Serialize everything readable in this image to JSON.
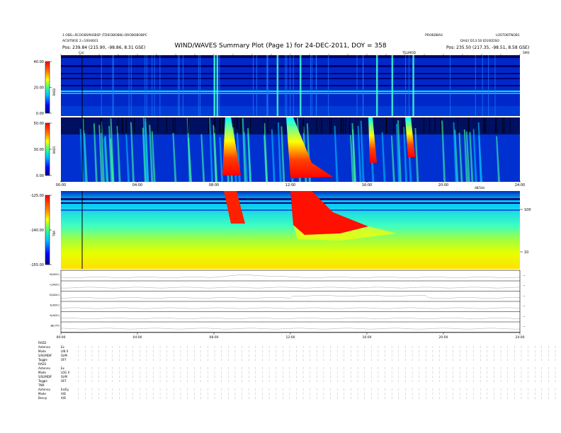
{
  "header": {
    "title": "WIND/WAVES Summary Plot (Page 1) for 24-DEC-2011, DOY = 358",
    "left_line1": "1 OBS=RCOOBSPAOBSP (TDIEOBOBN)-OROBOBOBPC",
    "left_line2": "ACSITBOE 2=1004601",
    "left_line3": "Pos:  239.84 (215.90, -98.86, 8.31 GSE)",
    "right_top_a": "PROBDBAS",
    "right_top_b": "LOSTOBTNOB1",
    "right_line2": "DAILY  D13:50 ID10EDSO",
    "right_line3": "Pos:  235.50 (217.35, -98.51, 8.58 GSE)",
    "cal_label": "Cal",
    "telmode_label": "TELMOD",
    "scale_label": "SM3"
  },
  "chart_data": [
    {
      "type": "heatmap",
      "panel": "RAD2",
      "ylabel": "RAD2",
      "yticks": [
        "40.00",
        "20.00",
        "0.00"
      ],
      "ylim": [
        0,
        40
      ],
      "colors": [
        "#00007f",
        "#0000ff",
        "#0080ff",
        "#00ffff",
        "#80ff80",
        "#ffff00",
        "#ff8000",
        "#ff0000"
      ]
    },
    {
      "type": "heatmap",
      "panel": "RAD1",
      "ylabel": "RAD1",
      "yticks": [
        "50.00",
        "30.00",
        "0.00"
      ],
      "ylim": [
        0,
        50
      ],
      "xticks": [
        "00:00",
        "04:00",
        "08:00",
        "12:00",
        "16:00",
        "20:00",
        "24:00"
      ],
      "bursts_hours": [
        8.0,
        8.15,
        11.3,
        12.5,
        16.5,
        17.3,
        18.4
      ]
    },
    {
      "type": "heatmap",
      "panel": "TNR",
      "ylabel": "TNR",
      "yticks": [
        "-125.00",
        "-140.00",
        "-155.00"
      ],
      "ylim": [
        -155,
        -125
      ],
      "right_ticks": [
        "100",
        "10"
      ],
      "right_label": "dB/1Hz"
    },
    {
      "type": "line",
      "panel": "status",
      "labels": [
        "B(ADC)",
        "C(ADC)",
        "D(ADC)",
        "E(ADC)",
        "A(ADC)",
        "BE(TT)"
      ],
      "xticks": [
        "00:00",
        "04:00",
        "08:00",
        "12:00",
        "16:00",
        "20:00",
        "24:00"
      ]
    }
  ],
  "footer": {
    "groups": [
      {
        "name": "RAD2",
        "rows": [
          [
            "Antenna",
            "Ex"
          ],
          [
            "Mode",
            "LIN X"
          ],
          [
            "S/SUMDIF",
            "SUM"
          ],
          [
            "Toggle",
            "OFF"
          ]
        ]
      },
      {
        "name": "RAD1",
        "rows": [
          [
            "Antenna",
            "Ex"
          ],
          [
            "Mode",
            "LOG X"
          ],
          [
            "S/SUMDIF",
            "SUM"
          ],
          [
            "Toggle",
            "OFF"
          ]
        ]
      },
      {
        "name": "TNR",
        "rows": [
          [
            "Antenna",
            "Ex/Ey"
          ],
          [
            "Mode",
            "A/B"
          ],
          [
            "Bnscp",
            "A/B"
          ]
        ]
      }
    ]
  }
}
